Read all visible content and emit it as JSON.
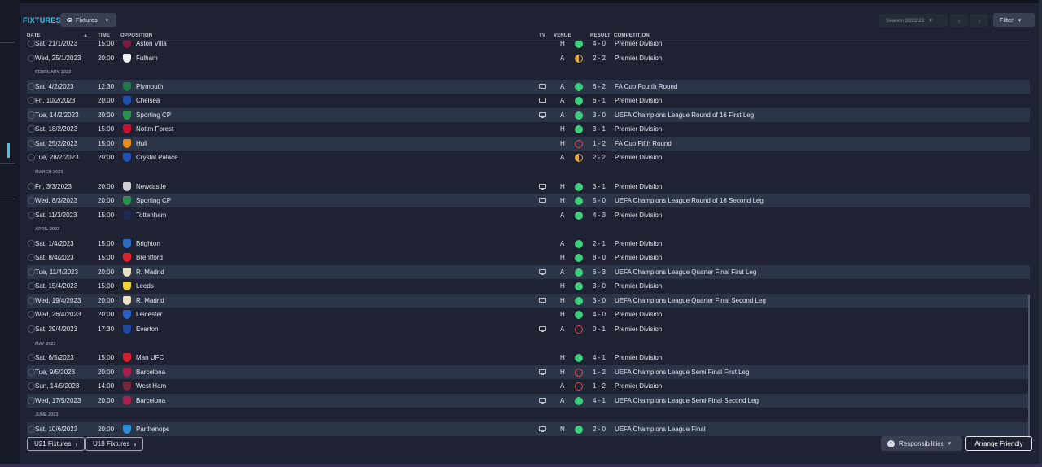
{
  "page": {
    "title": "FIXTURES",
    "view_selector": "Fixtures",
    "season": "Season 2022/23",
    "filter_label": "Filter"
  },
  "columns": {
    "date": "DATE",
    "time": "TIME",
    "opposition": "OPPOSITION",
    "tv": "TV",
    "venue": "VENUE",
    "result": "RESULT",
    "competition": "COMPETITION"
  },
  "colors": {
    "accent": "#41c7e6",
    "win": "#3ecf7c",
    "draw": "#e7a53a",
    "loss": "#e5484d"
  },
  "rows": [
    {
      "kind": "fixture",
      "date": "Sat, 21/1/2023",
      "time": "15:00",
      "opp": "Aston Villa",
      "crest": "#7a1c3e",
      "tv": false,
      "venue": "H",
      "outcome": "W",
      "score": "4 - 0",
      "comp": "Premier Division",
      "alt": false,
      "partial": true
    },
    {
      "kind": "fixture",
      "date": "Wed, 25/1/2023",
      "time": "20:00",
      "opp": "Fulham",
      "crest": "#f2f2f2",
      "tv": false,
      "venue": "A",
      "outcome": "D",
      "score": "2 - 2",
      "comp": "Premier Division",
      "alt": false
    },
    {
      "kind": "month",
      "label": "FEBRUARY 2023"
    },
    {
      "kind": "fixture",
      "date": "Sat, 4/2/2023",
      "time": "12:30",
      "opp": "Plymouth",
      "crest": "#1f7a4a",
      "tv": true,
      "venue": "A",
      "outcome": "W",
      "score": "6 - 2",
      "comp": "FA Cup Fourth Round",
      "alt": true
    },
    {
      "kind": "fixture",
      "date": "Fri, 10/2/2023",
      "time": "20:00",
      "opp": "Chelsea",
      "crest": "#1d4fa8",
      "tv": true,
      "venue": "A",
      "outcome": "W",
      "score": "6 - 1",
      "comp": "Premier Division",
      "alt": false
    },
    {
      "kind": "fixture",
      "date": "Tue, 14/2/2023",
      "time": "20:00",
      "opp": "Sporting CP",
      "crest": "#2d8f4e",
      "tv": true,
      "venue": "A",
      "outcome": "W",
      "score": "3 - 0",
      "comp": "UEFA Champions League Round of 16 First Leg",
      "alt": true
    },
    {
      "kind": "fixture",
      "date": "Sat, 18/2/2023",
      "time": "15:00",
      "opp": "Nottm Forest",
      "crest": "#c8102e",
      "tv": false,
      "venue": "H",
      "outcome": "W",
      "score": "3 - 1",
      "comp": "Premier Division",
      "alt": false
    },
    {
      "kind": "fixture",
      "date": "Sat, 25/2/2023",
      "time": "15:00",
      "opp": "Hull",
      "crest": "#e38b14",
      "tv": false,
      "venue": "H",
      "outcome": "L",
      "score": "1 - 2",
      "comp": "FA Cup Fifth Round",
      "alt": true
    },
    {
      "kind": "fixture",
      "date": "Tue, 28/2/2023",
      "time": "20:00",
      "opp": "Crystal Palace",
      "crest": "#2050b3",
      "tv": false,
      "venue": "A",
      "outcome": "D",
      "score": "2 - 2",
      "comp": "Premier Division",
      "alt": false
    },
    {
      "kind": "month",
      "label": "MARCH 2023"
    },
    {
      "kind": "fixture",
      "date": "Fri, 3/3/2023",
      "time": "20:00",
      "opp": "Newcastle",
      "crest": "#d0d0d0",
      "tv": true,
      "venue": "H",
      "outcome": "W",
      "score": "3 - 1",
      "comp": "Premier Division",
      "alt": false
    },
    {
      "kind": "fixture",
      "date": "Wed, 8/3/2023",
      "time": "20:00",
      "opp": "Sporting CP",
      "crest": "#2d8f4e",
      "tv": true,
      "venue": "H",
      "outcome": "W",
      "score": "5 - 0",
      "comp": "UEFA Champions League Round of 16 Second Leg",
      "alt": true
    },
    {
      "kind": "fixture",
      "date": "Sat, 11/3/2023",
      "time": "15:00",
      "opp": "Tottenham",
      "crest": "#1b2a52",
      "tv": false,
      "venue": "A",
      "outcome": "W",
      "score": "4 - 3",
      "comp": "Premier Division",
      "alt": false
    },
    {
      "kind": "month",
      "label": "APRIL 2023"
    },
    {
      "kind": "fixture",
      "date": "Sat, 1/4/2023",
      "time": "15:00",
      "opp": "Brighton",
      "crest": "#2a6cc4",
      "tv": false,
      "venue": "A",
      "outcome": "W",
      "score": "2 - 1",
      "comp": "Premier Division",
      "alt": false
    },
    {
      "kind": "fixture",
      "date": "Sat, 8/4/2023",
      "time": "15:00",
      "opp": "Brentford",
      "crest": "#d8232a",
      "tv": false,
      "venue": "H",
      "outcome": "W",
      "score": "8 - 0",
      "comp": "Premier Division",
      "alt": false
    },
    {
      "kind": "fixture",
      "date": "Tue, 11/4/2023",
      "time": "20:00",
      "opp": "R. Madrid",
      "crest": "#e9e2c6",
      "tv": true,
      "venue": "A",
      "outcome": "W",
      "score": "6 - 3",
      "comp": "UEFA Champions League Quarter Final First Leg",
      "alt": true
    },
    {
      "kind": "fixture",
      "date": "Sat, 15/4/2023",
      "time": "15:00",
      "opp": "Leeds",
      "crest": "#f1d23a",
      "tv": false,
      "venue": "H",
      "outcome": "W",
      "score": "3 - 0",
      "comp": "Premier Division",
      "alt": false
    },
    {
      "kind": "fixture",
      "date": "Wed, 19/4/2023",
      "time": "20:00",
      "opp": "R. Madrid",
      "crest": "#e9e2c6",
      "tv": true,
      "venue": "H",
      "outcome": "W",
      "score": "3 - 0",
      "comp": "UEFA Champions League Quarter Final Second Leg",
      "alt": true
    },
    {
      "kind": "fixture",
      "date": "Wed, 26/4/2023",
      "time": "20:00",
      "opp": "Leicester",
      "crest": "#2a5fc2",
      "tv": false,
      "venue": "H",
      "outcome": "W",
      "score": "4 - 0",
      "comp": "Premier Division",
      "alt": false
    },
    {
      "kind": "fixture",
      "date": "Sat, 29/4/2023",
      "time": "17:30",
      "opp": "Everton",
      "crest": "#1d4aa0",
      "tv": true,
      "venue": "A",
      "outcome": "L",
      "score": "0 - 1",
      "comp": "Premier Division",
      "alt": false
    },
    {
      "kind": "month",
      "label": "MAY 2023"
    },
    {
      "kind": "fixture",
      "date": "Sat, 6/5/2023",
      "time": "15:00",
      "opp": "Man UFC",
      "crest": "#d3202a",
      "tv": false,
      "venue": "H",
      "outcome": "W",
      "score": "4 - 1",
      "comp": "Premier Division",
      "alt": false
    },
    {
      "kind": "fixture",
      "date": "Tue, 9/5/2023",
      "time": "20:00",
      "opp": "Barcelona",
      "crest": "#a3234c",
      "tv": true,
      "venue": "H",
      "outcome": "L",
      "score": "1 - 2",
      "comp": "UEFA Champions League Semi Final First Leg",
      "alt": true
    },
    {
      "kind": "fixture",
      "date": "Sun, 14/5/2023",
      "time": "14:00",
      "opp": "West Ham",
      "crest": "#7a2638",
      "tv": false,
      "venue": "A",
      "outcome": "L",
      "score": "1 - 2",
      "comp": "Premier Division",
      "alt": false
    },
    {
      "kind": "fixture",
      "date": "Wed, 17/5/2023",
      "time": "20:00",
      "opp": "Barcelona",
      "crest": "#a3234c",
      "tv": true,
      "venue": "A",
      "outcome": "W",
      "score": "4 - 1",
      "comp": "UEFA Champions League Semi Final Second Leg",
      "alt": true
    },
    {
      "kind": "month",
      "label": "JUNE 2023"
    },
    {
      "kind": "fixture",
      "date": "Sat, 10/6/2023",
      "time": "20:00",
      "opp": "Parthenope",
      "crest": "#2a8fd6",
      "tv": true,
      "venue": "N",
      "outcome": "W",
      "score": "2 - 0",
      "comp": "UEFA Champions League Final",
      "alt": true
    }
  ],
  "footer": {
    "u21": "U21 Fixtures",
    "u18": "U18 Fixtures",
    "responsibilities": "Responsibilities",
    "arrange": "Arrange Friendly"
  }
}
